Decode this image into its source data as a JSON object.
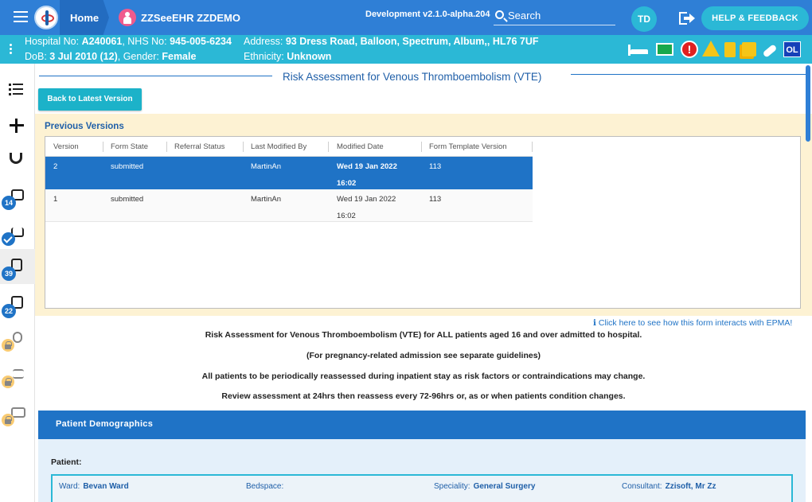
{
  "header": {
    "home_label": "Home",
    "patient_name": "ZZSeeEHR ZZDEMO",
    "version": "Development v2.1.0-alpha.204",
    "search_label": "Search",
    "user_initials": "TD",
    "help_label": "HELP & FEEDBACK"
  },
  "banner": {
    "hospital_label": "Hospital No:",
    "hospital_no": "A240061",
    "nhs_label": ", NHS No:",
    "nhs_no": "945-005-6234",
    "address_label": "Address:",
    "address": "93 Dress Road, Balloon, Spectrum, Album,, HL76 7UF",
    "dob_label": "DoB:",
    "dob": "3 Jul 2010 (12)",
    "gender_label": ", Gender:",
    "gender": "Female",
    "ethnicity_label": "Ethnicity:",
    "ethnicity": "Unknown",
    "flag_alert": "!",
    "flag_ol": "OL"
  },
  "sidebar": {
    "badge_1": "14",
    "badge_2": "39",
    "badge_3": "22"
  },
  "form": {
    "title": "Risk Assessment for Venous Thromboembolism (VTE)",
    "back_button": "Back to Latest Version",
    "previous_versions_title": "Previous Versions",
    "columns": [
      "Version",
      "Form State",
      "Referral Status",
      "Last Modified By",
      "Modified Date",
      "Form Template Version"
    ],
    "rows": [
      {
        "version": "2",
        "state": "submitted",
        "referral": "",
        "modified_by": "MartinAn",
        "date": "Wed 19 Jan 2022",
        "time": "16:02",
        "template": "113"
      },
      {
        "version": "1",
        "state": "submitted",
        "referral": "",
        "modified_by": "MartinAn",
        "date": "Wed 19 Jan 2022",
        "time": "16:02",
        "template": "113"
      }
    ],
    "epma_link": "ℹ Click here to see how this form interacts with EPMA!",
    "info_1": "Risk Assessment for Venous Thromboembolism (VTE) for ALL patients aged 16 and over admitted to hospital.",
    "info_2": "(For pregnancy-related admission see separate guidelines)",
    "info_3": "All patients to be periodically reassessed during inpatient stay as risk factors or contraindications may change.",
    "info_4": "Review assessment at 24hrs then reassess every 72-96hrs or, as or when patients condition changes.",
    "demographics_title": "Patient Demographics",
    "patient_label": "Patient:",
    "ward_label": "Ward:",
    "ward": "Bevan Ward",
    "bedspace_label": "Bedspace:",
    "bedspace": "",
    "speciality_label": "Speciality:",
    "speciality": "General Surgery",
    "consultant_label": "Consultant:",
    "consultant": "Zzisoft, Mr Zz"
  }
}
